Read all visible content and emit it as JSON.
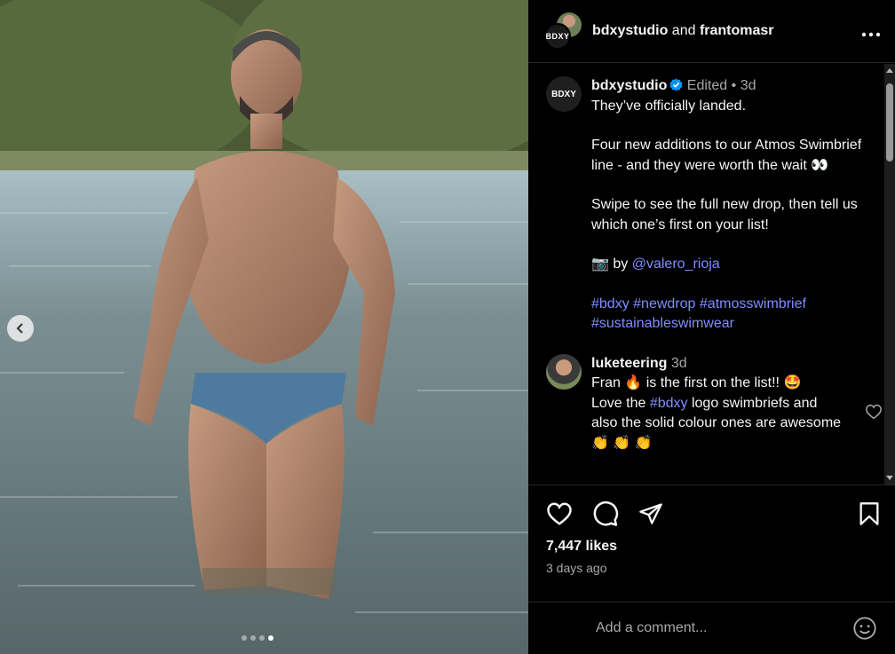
{
  "post": {
    "header": {
      "author": "bdxystudio",
      "joiner": "and",
      "coauthor": "frantomasr",
      "brand_mark": "BDXY"
    },
    "caption": {
      "author": "bdxystudio",
      "edited": "Edited",
      "separator": "•",
      "age": "3d",
      "line1": "They’ve officially landed.",
      "line2": "Four new additions to our Atmos Swimbrief line - and they were worth the wait 👀",
      "line3": "Swipe to see the full new drop, then tell us which one’s first on your list!",
      "credit_prefix": "📷 by ",
      "credit_handle": "@valero_rioja",
      "hashtags": [
        "#bdxy",
        "#newdrop",
        "#atmosswimbrief",
        "#sustainableswimwear"
      ]
    },
    "comment": {
      "author": "luketeering",
      "age": "3d",
      "part1": "Fran 🔥 is the first on the list!! 🤩",
      "part2": "Love the ",
      "hashtag": "#bdxy",
      "part3": " logo swimbriefs and also the solid colour ones are awesome 👏 👏 👏"
    },
    "likes": "7,447 likes",
    "posted": "3 days ago",
    "comment_input_placeholder": "Add a comment...",
    "carousel": {
      "count": 4,
      "active_index": 3
    }
  },
  "icons": {
    "more": "more-horizontal-icon",
    "like": "heart-icon",
    "comment": "comment-icon",
    "share": "send-icon",
    "save": "bookmark-icon",
    "emoji": "emoji-icon",
    "prev": "chevron-left-icon",
    "verified": "verified-badge-icon"
  },
  "colors": {
    "background": "#000000",
    "text": "#f5f5f5",
    "muted": "#a8a8a8",
    "link": "#7f8dff",
    "verified": "#0095f6",
    "divider": "#262626"
  }
}
